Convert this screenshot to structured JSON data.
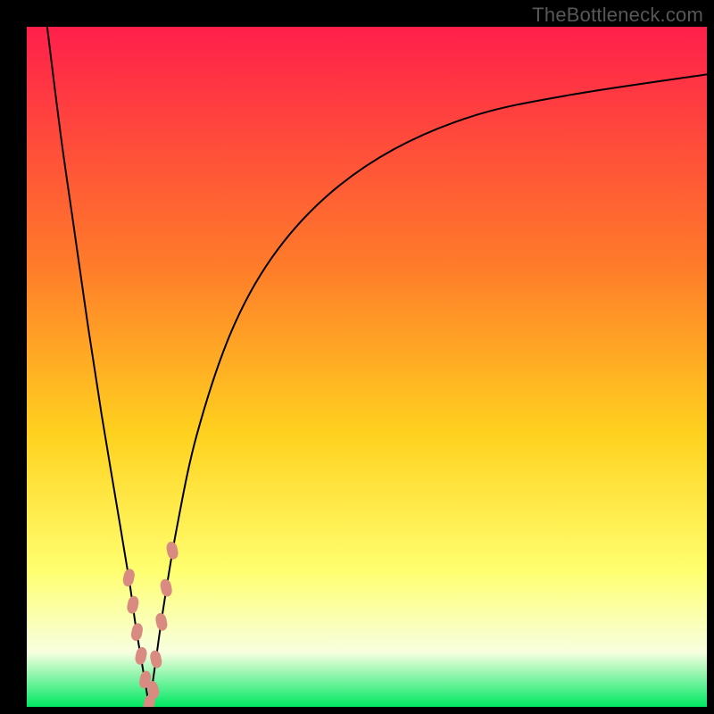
{
  "watermark": "TheBottleneck.com",
  "colors": {
    "gradient_top": "#ff1f4b",
    "gradient_mid_upper": "#ff7b2a",
    "gradient_mid": "#ffd21f",
    "gradient_mid_lower": "#ffff70",
    "gradient_pale": "#f7ffe0",
    "gradient_bottom": "#00e863",
    "curve_stroke": "#000000",
    "marker_fill": "#d98b82",
    "frame_bg": "#000000"
  },
  "chart_data": {
    "type": "line",
    "title": "",
    "xlabel": "",
    "ylabel": "",
    "xlim": [
      0,
      100
    ],
    "ylim": [
      0,
      100
    ],
    "optimum_x": 18,
    "series": [
      {
        "name": "left-branch",
        "x": [
          3,
          5,
          7,
          9,
          11,
          13,
          15,
          16,
          17,
          18
        ],
        "y": [
          100,
          84,
          70,
          56,
          43,
          31,
          19,
          12,
          6,
          0
        ]
      },
      {
        "name": "right-branch",
        "x": [
          18,
          19,
          20,
          22,
          25,
          30,
          36,
          44,
          54,
          66,
          80,
          100
        ],
        "y": [
          0,
          7,
          14,
          26,
          40,
          55,
          66,
          75,
          82,
          87,
          90,
          93
        ]
      }
    ],
    "markers": [
      {
        "series": "left-branch",
        "x": 15.0,
        "y": 19.0
      },
      {
        "series": "left-branch",
        "x": 15.6,
        "y": 15.0
      },
      {
        "series": "left-branch",
        "x": 16.2,
        "y": 11.0
      },
      {
        "series": "left-branch",
        "x": 16.8,
        "y": 7.5
      },
      {
        "series": "left-branch",
        "x": 17.4,
        "y": 4.0
      },
      {
        "series": "left-branch",
        "x": 18.0,
        "y": 0.5
      },
      {
        "series": "right-branch",
        "x": 18.6,
        "y": 2.5
      },
      {
        "series": "right-branch",
        "x": 19.0,
        "y": 7.0
      },
      {
        "series": "right-branch",
        "x": 19.8,
        "y": 12.5
      },
      {
        "series": "right-branch",
        "x": 20.5,
        "y": 17.5
      },
      {
        "series": "right-branch",
        "x": 21.4,
        "y": 23.0
      }
    ]
  }
}
